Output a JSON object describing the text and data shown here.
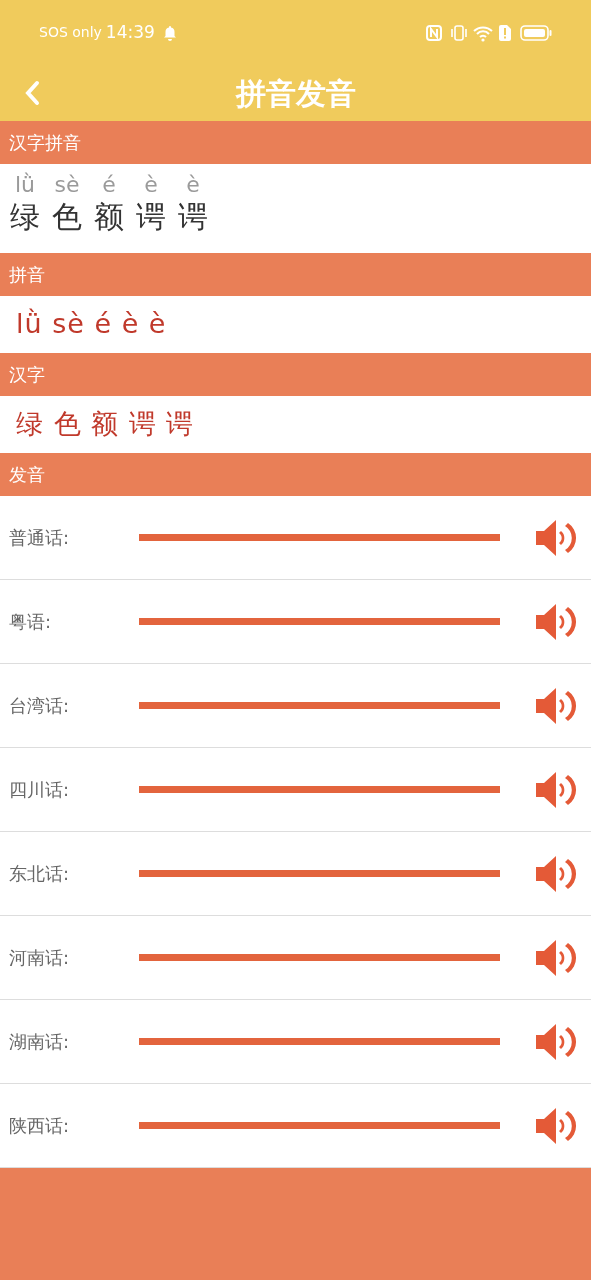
{
  "status_bar": {
    "carrier": "SOS only",
    "time": "14:39"
  },
  "header": {
    "title": "拼音发音"
  },
  "sections": [
    {
      "kind": "ruby",
      "title": "汉字拼音",
      "pairs": [
        {
          "pinyin": "lǜ",
          "hanzi": "绿"
        },
        {
          "pinyin": "sè",
          "hanzi": "色"
        },
        {
          "pinyin": "é",
          "hanzi": "额"
        },
        {
          "pinyin": "è",
          "hanzi": "谔"
        },
        {
          "pinyin": "è",
          "hanzi": "谔"
        }
      ]
    },
    {
      "kind": "text",
      "title": "拼音",
      "text": "lǜ sè é è è"
    },
    {
      "kind": "text",
      "title": "汉字",
      "text": "绿 色 额 谔 谔"
    },
    {
      "kind": "audio",
      "title": "发音",
      "rows": [
        {
          "label": "普通话:"
        },
        {
          "label": "粤语:"
        },
        {
          "label": "台湾话:"
        },
        {
          "label": "四川话:"
        },
        {
          "label": "东北话:"
        },
        {
          "label": "河南话:"
        },
        {
          "label": "湖南话:"
        },
        {
          "label": "陕西话:"
        }
      ]
    }
  ]
}
